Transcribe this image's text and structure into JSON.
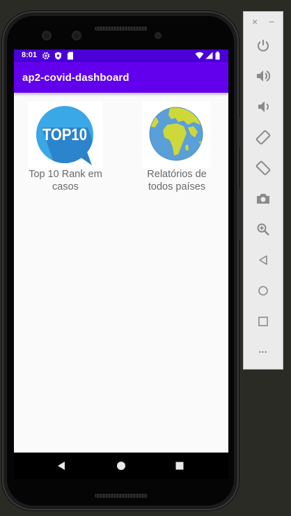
{
  "status_bar": {
    "time": "8:01",
    "icons": [
      "settings-icon",
      "shield-icon",
      "sd-card-icon",
      "wifi-icon",
      "signal-icon",
      "battery-icon"
    ],
    "color": "#4a00d6"
  },
  "app_bar": {
    "title": "ap2-covid-dashboard",
    "color": "#6200ee"
  },
  "tiles": [
    {
      "label": "Top 10 Rank em casos",
      "image_text": "TOP10",
      "icon": "top10-badge-icon"
    },
    {
      "label": "Relatórios de todos países",
      "icon": "globe-icon"
    }
  ],
  "nav_bar": {
    "buttons": [
      "back-icon",
      "home-icon",
      "recents-icon"
    ]
  },
  "emulator_panel": {
    "window_controls": [
      "close-icon",
      "minimize-icon"
    ],
    "buttons": [
      "power-icon",
      "volume-up-icon",
      "volume-down-icon",
      "rotate-left-icon",
      "rotate-right-icon",
      "camera-icon",
      "zoom-icon",
      "back-icon",
      "home-icon",
      "overview-icon",
      "more-icon"
    ],
    "close_glyph": "×",
    "minimize_glyph": "−",
    "more_glyph": "•••"
  }
}
